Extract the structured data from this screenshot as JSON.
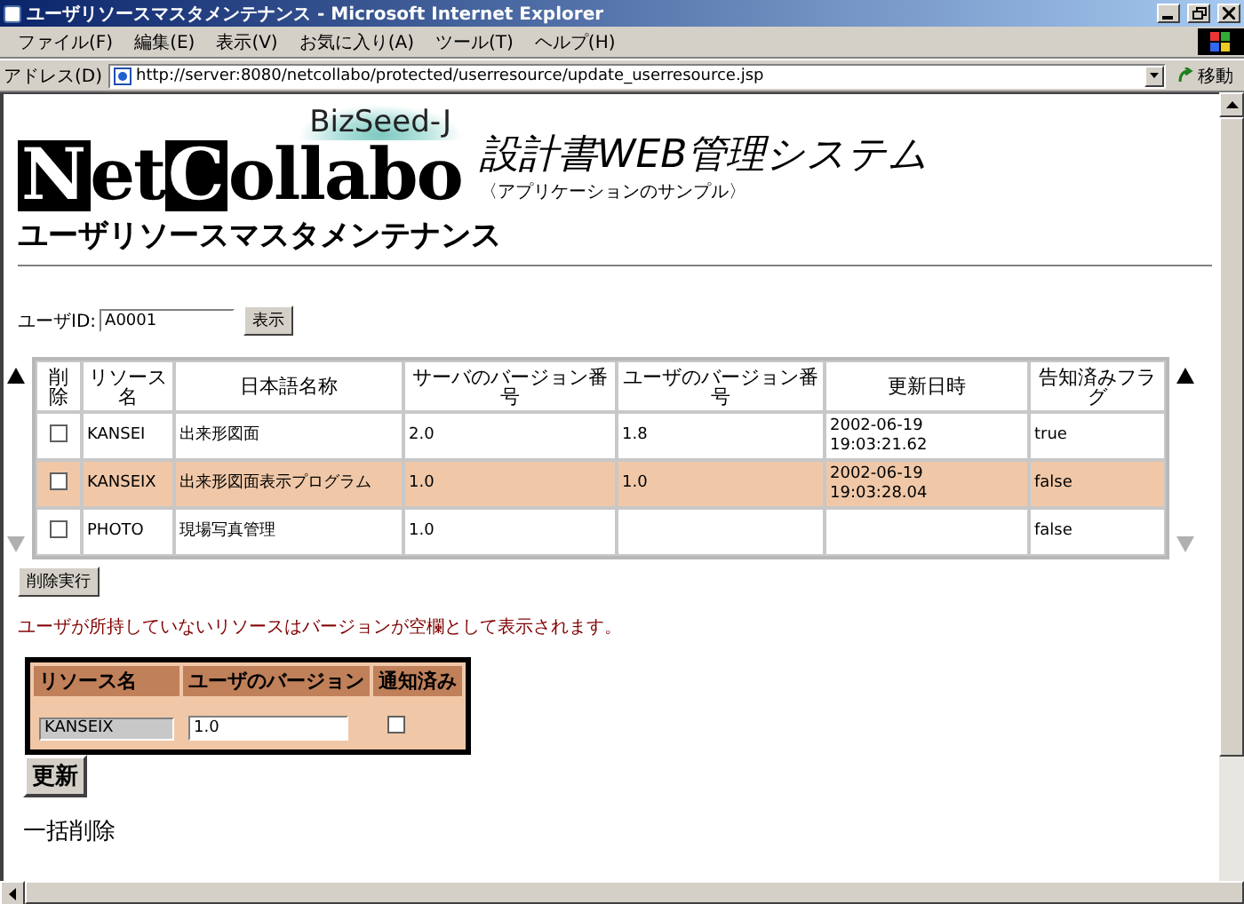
{
  "window": {
    "title": "ユーザリソースマスタメンテナンス - Microsoft Internet Explorer"
  },
  "menu": [
    "ファイル(F)",
    "編集(E)",
    "表示(V)",
    "お気に入り(A)",
    "ツール(T)",
    "ヘルプ(H)"
  ],
  "address_bar": {
    "label": "アドレス(D)",
    "url": "http://server:8080/netcollabo/protected/userresource/update_userresource.jsp",
    "go_label": "移動"
  },
  "logo": {
    "tagline": "BizSeed-J",
    "parts": [
      {
        "text": "N",
        "boxed": true
      },
      {
        "text": "et",
        "boxed": false
      },
      {
        "text": "C",
        "boxed": true
      },
      {
        "text": "ollabo",
        "boxed": false
      }
    ]
  },
  "app_title": "設計書WEB管理システム",
  "app_subtitle": "〈アプリケーションのサンプル〉",
  "page_title": "ユーザリソースマスタメンテナンス",
  "user_id": {
    "label": "ユーザID:",
    "value": "A0001",
    "button": "表示"
  },
  "resource_table": {
    "checkbox_column": "削除",
    "columns": [
      "リソース名",
      "日本語名称",
      "サーバのバージョン番号",
      "ユーザのバージョン番号",
      "更新日時",
      "告知済みフラグ"
    ],
    "rows": [
      {
        "checked": false,
        "selected": false,
        "cells": [
          "KANSEI",
          "出来形図面",
          "2.0",
          "1.8",
          "2002-06-19 19:03:21.62",
          "true"
        ]
      },
      {
        "checked": false,
        "selected": true,
        "cells": [
          "KANSEIX",
          "出来形図面表示プログラム",
          "1.0",
          "1.0",
          "2002-06-19 19:03:28.04",
          "false"
        ]
      },
      {
        "checked": false,
        "selected": false,
        "cells": [
          "PHOTO",
          "現場写真管理",
          "1.0",
          "",
          "",
          "false"
        ]
      }
    ]
  },
  "delete_button": "削除実行",
  "note": "ユーザが所持していないリソースはバージョンが空欄として表示されます。",
  "edit_form": {
    "columns": [
      "リソース名",
      "ユーザのバージョン",
      "通知済み"
    ],
    "resource_name": "KANSEIX",
    "user_version": "1.0",
    "notified": false
  },
  "update_button": "更新",
  "bulk_delete_heading": "一括削除"
}
